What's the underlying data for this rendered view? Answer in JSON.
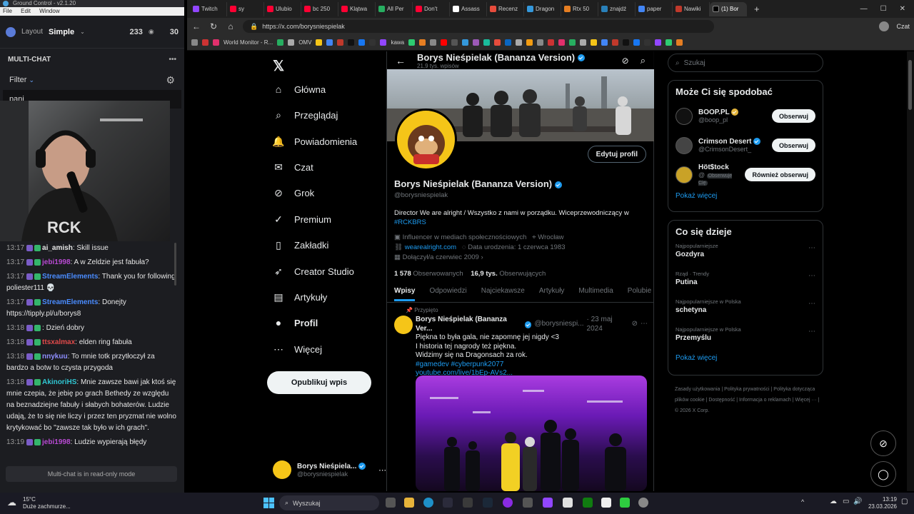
{
  "leftapp": {
    "title": "Ground Control - v2.1.20",
    "menu": [
      "File",
      "Edit",
      "Window"
    ],
    "layout_label": "Layout",
    "layout_value": "Simple",
    "viewers": "233",
    "count2": "30",
    "multichat_title": "MULTI-CHAT",
    "filter_label": "Filter",
    "filter_value": "pani",
    "readonly": "Multi-chat is in read-only mode",
    "messages": [
      {
        "time": "13:17",
        "user": "ai_amish",
        "ucolor": "#e6e6e6",
        "text": "Skill issue"
      },
      {
        "time": "13:17",
        "user": "jebi1998",
        "ucolor": "#b84ad3",
        "text": "A w Zeldzie jest fabuła?"
      },
      {
        "time": "13:17",
        "user": "StreamElements",
        "ucolor": "#4a8cff",
        "text": "Thank you for following poliester111 💀"
      },
      {
        "time": "13:17",
        "user": "StreamElements",
        "ucolor": "#4a8cff",
        "text": "Donejty https://tipply.pl/u/borys8"
      },
      {
        "time": "13:18",
        "user": "",
        "ucolor": "#3d3df0",
        "text": "Dzień dobry"
      },
      {
        "time": "13:18",
        "user": "ttsxalmax",
        "ucolor": "#e04a4a",
        "text": "elden ring fabuła"
      },
      {
        "time": "13:18",
        "user": "nnykuu",
        "ucolor": "#8f8fff",
        "text": "To mnie totk przytłoczył za bardzo a botw to czysta przygoda"
      },
      {
        "time": "13:18",
        "user": "AkinoriHS",
        "ucolor": "#30c7d3",
        "text": "Mnie zawsze bawi jak ktoś się mnie czepia, że jebię po grach Bethedy ze względu na beznadziejne fabuły i słabych bohaterów. Ludzie udają, że to się nie liczy i przez ten pryzmat nie wolno krytykować bo \"zawsze tak było w ich grach\"."
      },
      {
        "time": "13:19",
        "user": "jebi1998",
        "ucolor": "#b84ad3",
        "text": "Ludzie wypierają błędy"
      }
    ]
  },
  "browser": {
    "tabs": [
      {
        "label": "Twitch",
        "color": "#9146ff"
      },
      {
        "label": "sy",
        "color": "#ff0033"
      },
      {
        "label": "Ulubio",
        "color": "#ff0033"
      },
      {
        "label": "bc 250",
        "color": "#ff0033"
      },
      {
        "label": "Klątwa",
        "color": "#ff0033"
      },
      {
        "label": "All Per",
        "color": "#27ae60"
      },
      {
        "label": "Don't",
        "color": "#ff0033"
      },
      {
        "label": "Assass",
        "color": "#ffffff"
      },
      {
        "label": "Recenz",
        "color": "#e74c3c"
      },
      {
        "label": "Dragon",
        "color": "#3498db"
      },
      {
        "label": "Rtx 50",
        "color": "#e67e22"
      },
      {
        "label": "znajdź",
        "color": "#2980b9"
      },
      {
        "label": "paper",
        "color": "#4285f4"
      },
      {
        "label": "Nawiki",
        "color": "#c0392b"
      },
      {
        "label": "(1) Bor",
        "color": "#000000"
      }
    ],
    "url": "https://x.com/borysniespielak",
    "bookmarks": [
      "World Monitor - R...",
      "OMV",
      "kawa"
    ]
  },
  "x": {
    "nav": [
      {
        "icon": "home-icon",
        "glyph": "⌂",
        "label": "Główna"
      },
      {
        "icon": "search-icon",
        "glyph": "⌕",
        "label": "Przeglądaj"
      },
      {
        "icon": "bell-icon",
        "glyph": "🔔",
        "label": "Powiadomienia"
      },
      {
        "icon": "mail-icon",
        "glyph": "✉",
        "label": "Czat"
      },
      {
        "icon": "grok-icon",
        "glyph": "⊘",
        "label": "Grok"
      },
      {
        "icon": "premium-icon",
        "glyph": "✓",
        "label": "Premium"
      },
      {
        "icon": "bookmark-icon",
        "glyph": "▯",
        "label": "Zakładki"
      },
      {
        "icon": "rocket-icon",
        "glyph": "➶",
        "label": "Creator Studio"
      },
      {
        "icon": "article-icon",
        "glyph": "▤",
        "label": "Artykuły"
      },
      {
        "icon": "profile-icon",
        "glyph": "●",
        "label": "Profil"
      },
      {
        "icon": "more-icon",
        "glyph": "⋯",
        "label": "Więcej"
      }
    ],
    "post_button": "Opublikuj wpis",
    "account_name": "Borys Nieśpiela...",
    "account_handle": "@borysniespielak",
    "header_name": "Borys Nieśpielak (Bananza Version)",
    "header_posts": "21,9 tys. wpisów",
    "edit_profile": "Edytuj profil",
    "profile_name": "Borys Nieśpielak (Bananza Version)",
    "profile_handle": "@borysniespielak",
    "bio": "Director We are alright / Wszystko z nami w porządku. Wiceprzewodniczący w",
    "bio_link": "#RCKBRS",
    "category": "Influencer w mediach społecznościowych",
    "location": "Wrocław",
    "website": "wearealright.com",
    "birth": "Data urodzenia: 1 czerwca 1983",
    "joined": "Dołączył/a czerwiec 2009",
    "following_count": "1 578",
    "following_label": "Obserwowanych",
    "followers_count": "16,9 tys.",
    "followers_label": "Obserwujących",
    "profile_tabs": [
      "Wpisy",
      "Odpowiedzi",
      "Najciekawsze",
      "Artykuły",
      "Multimedia",
      "Polubie"
    ],
    "pinned_label": "Przypięto",
    "post_author": "Borys Nieśpielak (Bananza Ver...",
    "post_handle": "@borysniespi...",
    "post_date": "· 23 maj 2024",
    "post_lines": [
      "Piękna to była gala, nie zapomnę jej nigdy <3",
      "I historia tej nagrody też piękna.",
      "Widzimy się na Dragonsach za rok."
    ],
    "post_tags": "#gamedev #cyberpunk2077",
    "post_link": "youtube.com/live/1bEp-AVs2...",
    "search_placeholder": "Szukaj",
    "who_title": "Może Ci się spodobać",
    "who": [
      {
        "name": "BOOP.PL",
        "handle": "@boop_pl",
        "button": "Obserwuj",
        "color": "#111111",
        "badge": "gold"
      },
      {
        "name": "Crimson Desert",
        "handle": "@CrimsonDesert_",
        "button": "Obserwuj",
        "color": "#444444",
        "badge": "blue"
      },
      {
        "name": "Höt$tock",
        "handle": "@",
        "extra": "Obserwuje Cię",
        "button": "Również obserwuj",
        "color": "#c9a227",
        "badge": ""
      }
    ],
    "show_more": "Pokaż więcej",
    "trends_title": "Co się dzieje",
    "trends": [
      {
        "cat": "Najpopularniejsze",
        "name": "Gozdyra"
      },
      {
        "cat": "Rząd · Trendy",
        "name": "Putina"
      },
      {
        "cat": "Najpopularniejsze w Polska",
        "name": "schetyna"
      },
      {
        "cat": "Najpopularniejsze w Polska",
        "name": "Przemyślu"
      }
    ],
    "footer": [
      "Zasady użytkowania",
      "Polityka prywatności",
      "Polityka dotycząca plików cookie",
      "Dostępność",
      "Informacja o reklamach",
      "Więcej ···",
      "© 2026 X Corp."
    ]
  },
  "taskbar": {
    "temp": "15°C",
    "weather": "Duże zachmurze...",
    "search": "Wyszukaj",
    "time": "13:19",
    "date": "23.03.2026"
  }
}
